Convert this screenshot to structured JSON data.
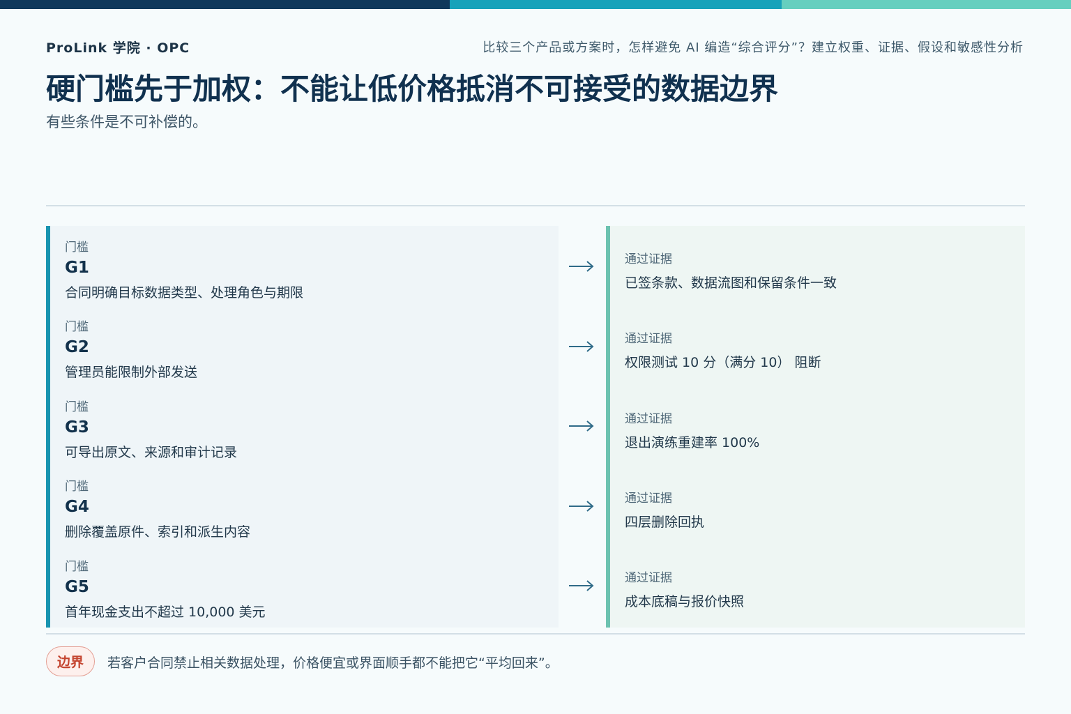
{
  "header": {
    "brand": "ProLink 学院 · OPC",
    "series": "比较三个产品或方案时，怎样避免 AI 编造“综合评分”？建立权重、证据、假设和敏感性分析"
  },
  "title": "硬门槛先于加权：不能让低价格抵消不可接受的数据边界",
  "subtitle": "有些条件是不可补偿的。",
  "gates": [
    {
      "kicker": "门槛",
      "id": "G1",
      "desc": "合同明确目标数据类型、处理角色与期限",
      "evidence_kicker": "通过证据",
      "evidence": "已签条款、数据流图和保留条件一致"
    },
    {
      "kicker": "门槛",
      "id": "G2",
      "desc": "管理员能限制外部发送",
      "evidence_kicker": "通过证据",
      "evidence": "权限测试 10 分（满分 10） 阻断"
    },
    {
      "kicker": "门槛",
      "id": "G3",
      "desc": "可导出原文、来源和审计记录",
      "evidence_kicker": "通过证据",
      "evidence": "退出演练重建率 100%"
    },
    {
      "kicker": "门槛",
      "id": "G4",
      "desc": "删除覆盖原件、索引和派生内容",
      "evidence_kicker": "通过证据",
      "evidence": "四层删除回执"
    },
    {
      "kicker": "门槛",
      "id": "G5",
      "desc": "首年现金支出不超过 10,000 美元",
      "evidence_kicker": "通过证据",
      "evidence": "成本底稿与报价快照"
    }
  ],
  "footer": {
    "badge": "边界",
    "note": "若客户合同禁止相关数据处理，价格便宜或界面顺手都不能把它“平均回来”。"
  },
  "colors": {
    "accent_dark": "#11385b",
    "accent_teal": "#18a2ba",
    "accent_mint": "#66cfbf",
    "warning": "#c4442f"
  }
}
